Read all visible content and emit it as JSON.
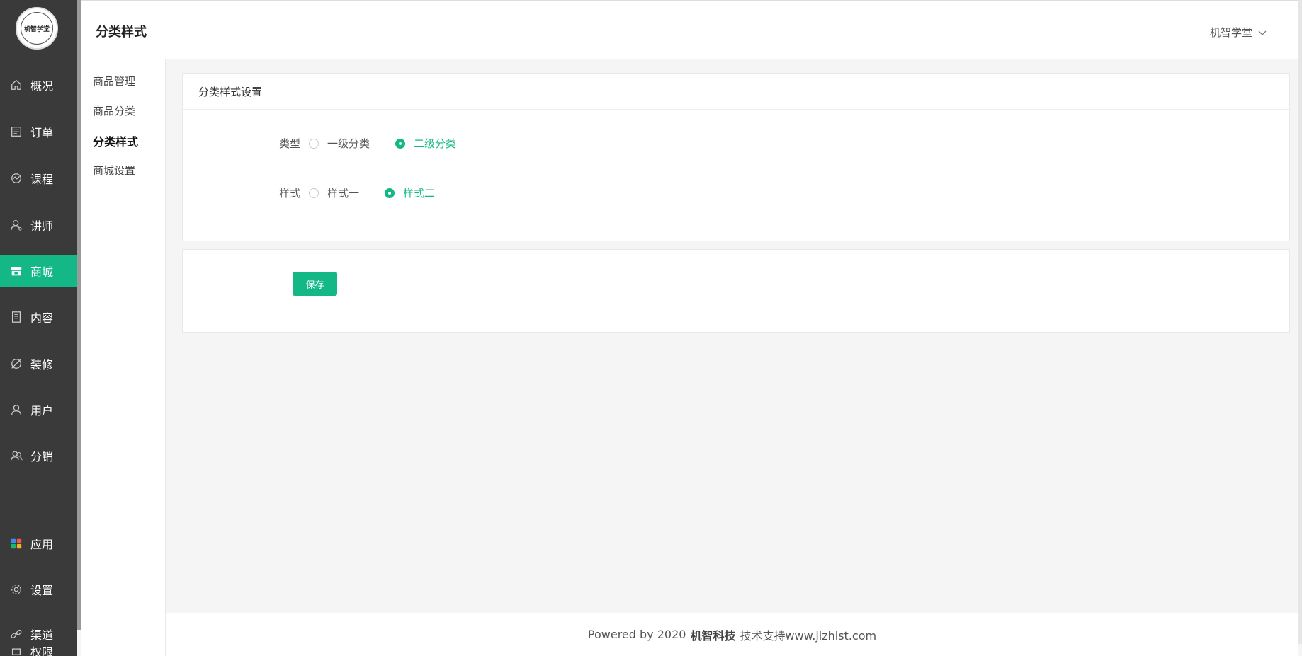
{
  "logo": {
    "text": "机智学堂"
  },
  "header": {
    "title": "分类样式",
    "user_name": "机智学堂"
  },
  "main_nav": [
    {
      "label": "概况",
      "icon": "home-icon"
    },
    {
      "label": "订单",
      "icon": "order-icon"
    },
    {
      "label": "课程",
      "icon": "course-icon"
    },
    {
      "label": "讲师",
      "icon": "teacher-icon"
    },
    {
      "label": "商城",
      "icon": "store-icon",
      "active": true
    },
    {
      "label": "内容",
      "icon": "content-icon"
    },
    {
      "label": "装修",
      "icon": "decorate-icon"
    },
    {
      "label": "用户",
      "icon": "user-icon"
    },
    {
      "label": "分销",
      "icon": "distribution-icon"
    },
    {
      "label": "应用",
      "icon": "apps-icon"
    },
    {
      "label": "设置",
      "icon": "gear-icon"
    },
    {
      "label": "渠道",
      "icon": "link-icon"
    },
    {
      "label": "权限",
      "icon": "permission-icon"
    }
  ],
  "sub_menu": [
    {
      "label": "商品管理"
    },
    {
      "label": "商品分类"
    },
    {
      "label": "分类样式",
      "active": true
    },
    {
      "label": "商城设置"
    }
  ],
  "settings_card": {
    "title": "分类样式设置",
    "type_label": "类型",
    "type_options": [
      {
        "label": "一级分类",
        "checked": false
      },
      {
        "label": "二级分类",
        "checked": true
      }
    ],
    "style_label": "样式",
    "style_options": [
      {
        "label": "样式一",
        "checked": false
      },
      {
        "label": "样式二",
        "checked": true
      }
    ]
  },
  "actions": {
    "save_label": "保存"
  },
  "footer": {
    "prefix": "Powered by 2020",
    "brand": "机智科技",
    "suffix": "技术支持www.jizhist.com"
  },
  "colors": {
    "accent": "#13b886",
    "sidebar_bg": "#3a3a3a"
  }
}
